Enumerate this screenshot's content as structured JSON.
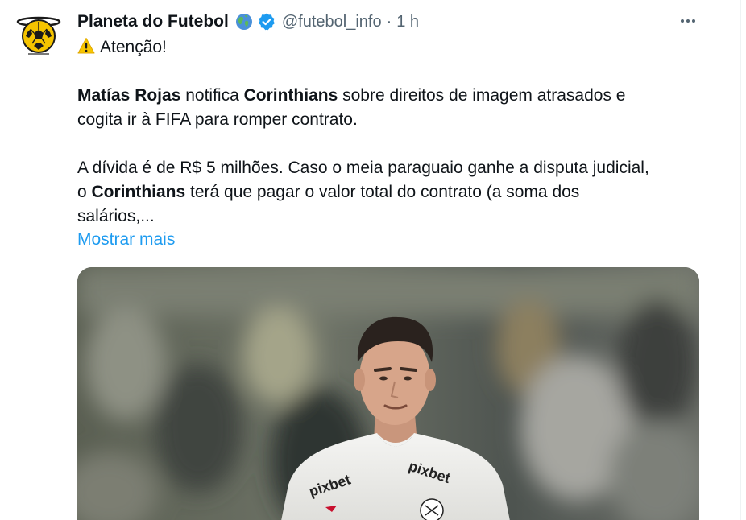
{
  "account": {
    "display_name": "Planeta do Futebol",
    "handle": "@futebol_info",
    "separator": "·",
    "time": "1 h",
    "avatar_icon": "soccer-ball-logo-icon",
    "badges": [
      "globe-icon",
      "verified-badge-icon"
    ]
  },
  "tweet": {
    "warning_icon": "warning-icon",
    "line1": "Atenção!",
    "p1": {
      "bold1": "Matías Rojas",
      "t1": " notifica ",
      "bold2": "Corinthians",
      "t2": " sobre direitos de imagem atrasados e",
      "line2": "cogita ir à FIFA para romper contrato."
    },
    "p2": {
      "line1": "A dívida é de R$ 5 milhões. Caso o meia paraguaio ganhe a disputa judicial,",
      "l2a": "o ",
      "l2bold": "Corinthians",
      "l2b": " terá que pagar o valor total do contrato (a soma dos",
      "line3": "salários,..."
    },
    "show_more": "Mostrar mais"
  },
  "media": {
    "jersey_sponsor": "pixbet"
  },
  "colors": {
    "accent": "#1d9bf0",
    "text": "#0f1419",
    "secondary": "#536471",
    "logo_yellow": "#f5c400"
  }
}
